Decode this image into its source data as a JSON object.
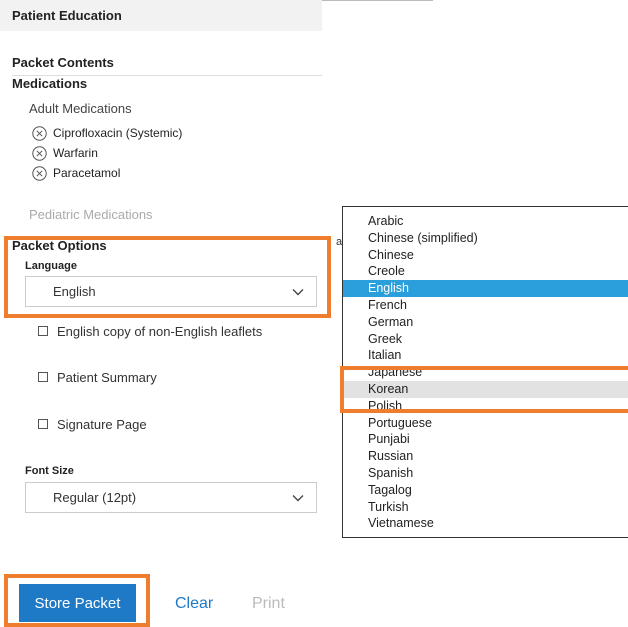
{
  "header": {
    "title": "Patient Education"
  },
  "packet_contents": {
    "title": "Packet Contents",
    "medications_title": "Medications",
    "adult_label": "Adult Medications",
    "adult_meds": [
      "Ciprofloxacin (Systemic)",
      "Warfarin",
      "Paracetamol"
    ],
    "pediatric_label": "Pediatric Medications"
  },
  "packet_options": {
    "title": "Packet Options",
    "language_label": "Language",
    "language_value": "English",
    "checkboxes": [
      "English copy of non-English leaflets",
      "Patient Summary",
      "Signature Page"
    ],
    "font_size_label": "Font Size",
    "font_size_value": "Regular (12pt)"
  },
  "cut_off_text": "a",
  "language_dropdown": {
    "options": [
      "Arabic",
      "Chinese (simplified)",
      "Chinese",
      "Creole",
      "English",
      "French",
      "German",
      "Greek",
      "Italian",
      "Japanese",
      "Korean",
      "Polish",
      "Portuguese",
      "Punjabi",
      "Russian",
      "Spanish",
      "Tagalog",
      "Turkish",
      "Vietnamese"
    ],
    "selected": "English",
    "hovered": "Korean"
  },
  "actions": {
    "store_label": "Store Packet",
    "clear_label": "Clear",
    "print_label": "Print"
  },
  "colors": {
    "accent": "#1e79c6",
    "selected_option": "#2a9fdc",
    "highlight": "#ef7d2e"
  },
  "icons": {
    "remove": "circle-x-icon",
    "dropdown": "chevron-down-icon"
  }
}
